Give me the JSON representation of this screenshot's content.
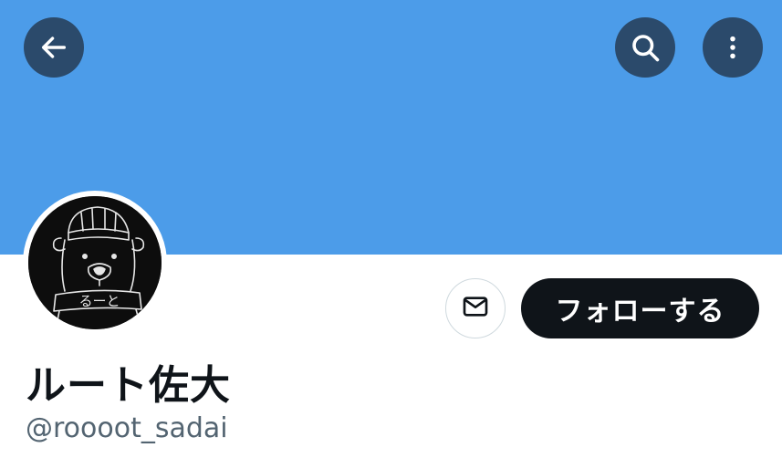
{
  "colors": {
    "banner": "#4c9ce9",
    "overlay_button": "#2b4a6b",
    "follow_button": "#0f1419",
    "text_primary": "#0f1419",
    "text_secondary": "#536471"
  },
  "header": {
    "back_icon": "arrow-left-icon",
    "search_icon": "search-icon",
    "more_icon": "more-vertical-icon"
  },
  "profile": {
    "display_name": "ルート佐大",
    "handle": "@roooot_sadai",
    "avatar_text": "るーと"
  },
  "actions": {
    "message_icon": "envelope-icon",
    "follow_label": "フォローする"
  }
}
